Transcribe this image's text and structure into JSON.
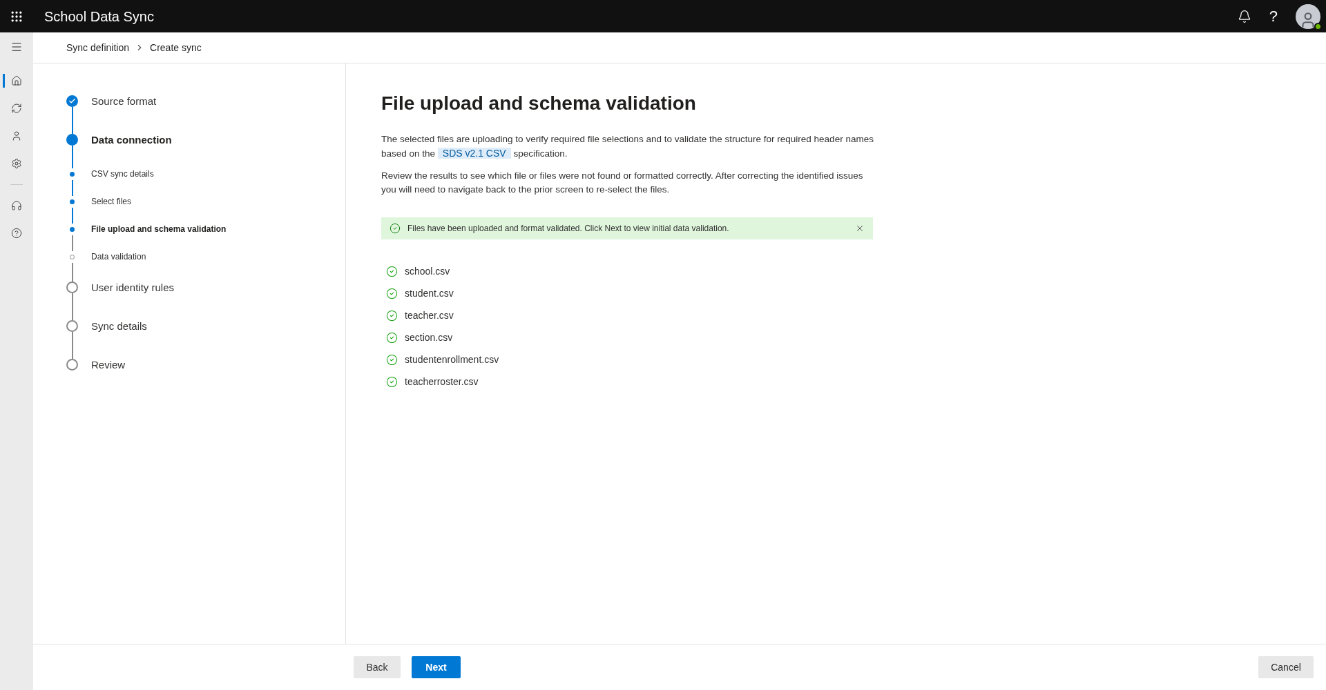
{
  "header": {
    "title": "School Data Sync",
    "help": "?"
  },
  "nav_rail": [
    {
      "selected": true
    },
    {
      "selected": false
    },
    {
      "selected": false
    },
    {
      "selected": false
    },
    {
      "selected": false
    },
    {
      "selected": false
    }
  ],
  "breadcrumb": [
    "Sync definition",
    "Create sync"
  ],
  "steps": [
    {
      "label": "Source format",
      "kind": "major",
      "done": true,
      "current": false
    },
    {
      "label": "Data connection",
      "kind": "major",
      "done": false,
      "current": true
    },
    {
      "label": "CSV sync details",
      "kind": "minor",
      "done": true,
      "current": false
    },
    {
      "label": "Select files",
      "kind": "minor",
      "done": true,
      "current": false
    },
    {
      "label": "File upload and schema validation",
      "kind": "minor",
      "done": false,
      "current": true
    },
    {
      "label": "Data validation",
      "kind": "minor",
      "done": false,
      "current": false
    },
    {
      "label": "User identity rules",
      "kind": "major",
      "done": false,
      "current": false
    },
    {
      "label": "Sync details",
      "kind": "major",
      "done": false,
      "current": false
    },
    {
      "label": "Review",
      "kind": "major",
      "done": false,
      "current": false
    }
  ],
  "page_title": "File upload and schema validation",
  "intro": {
    "before": "The selected files are uploading to verify required file selections and to validate the structure for required header names based on the",
    "link": "SDS v2.1 CSV",
    "after": "specification."
  },
  "review_text": "Review the results to see which file or files were not found or formatted correctly. After correcting the identified issues you will need to navigate back to the prior screen to re-select the files.",
  "banner": {
    "kind": "success",
    "message": "Files have been uploaded and format validated. Click Next to view initial data validation."
  },
  "files": [
    {
      "name": "school.csv",
      "valid": true
    },
    {
      "name": "student.csv",
      "valid": true
    },
    {
      "name": "teacher.csv",
      "valid": true
    },
    {
      "name": "section.csv",
      "valid": true
    },
    {
      "name": "studentenrollment.csv",
      "valid": true
    },
    {
      "name": "teacherroster.csv",
      "valid": true
    }
  ],
  "footer": {
    "back": "Back",
    "next": "Next",
    "cancel": "Cancel"
  }
}
